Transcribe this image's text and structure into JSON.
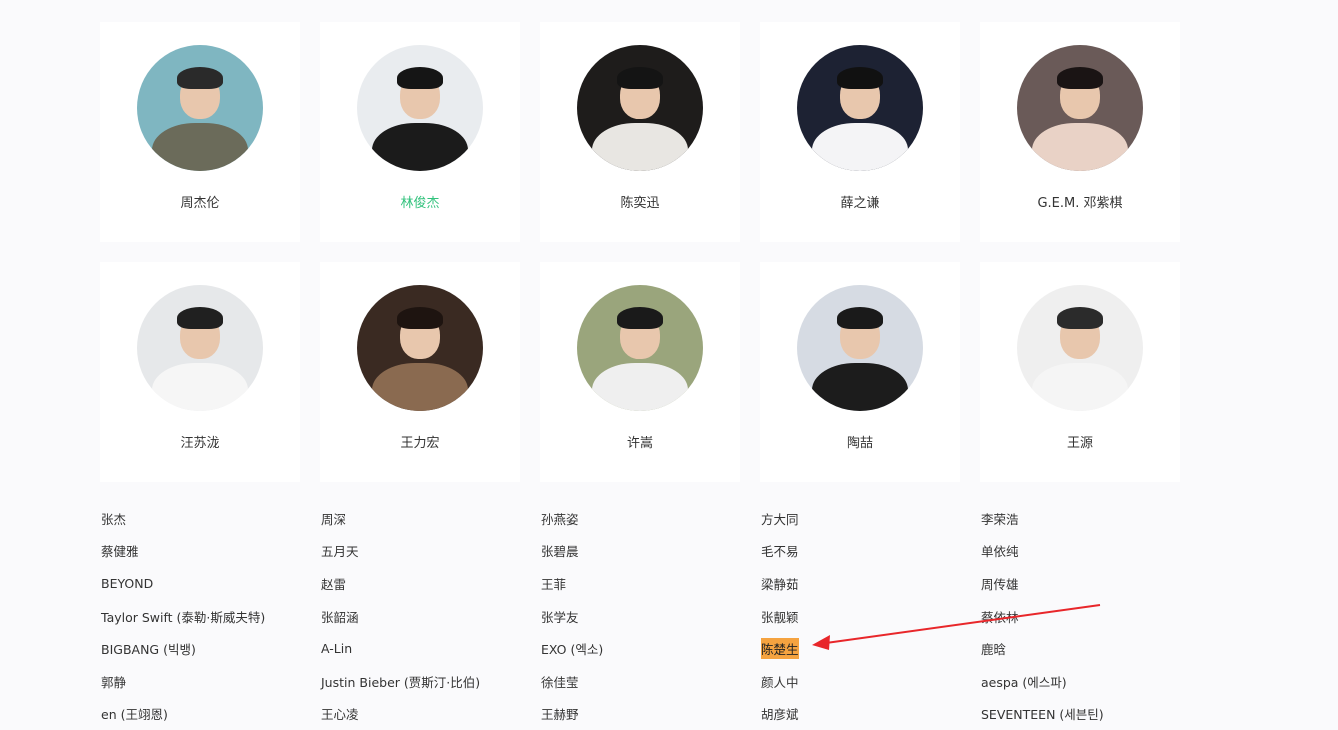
{
  "featured_singers": [
    {
      "name": "周杰伦",
      "active": false,
      "bg": "#7fb6c1",
      "body": "#6b6b5a",
      "hair": "#2a2a2a"
    },
    {
      "name": "林俊杰",
      "active": true,
      "bg": "#e9ecef",
      "body": "#1b1b1b",
      "hair": "#151515"
    },
    {
      "name": "陈奕迅",
      "active": false,
      "bg": "#1e1c1b",
      "body": "#e8e6e2",
      "hair": "#141414"
    },
    {
      "name": "薛之谦",
      "active": false,
      "bg": "#1d2233",
      "body": "#f4f4f6",
      "hair": "#111111"
    },
    {
      "name": "G.E.M. 邓紫棋",
      "active": false,
      "bg": "#6a5a58",
      "body": "#e9d2c6",
      "hair": "#1a1414"
    },
    {
      "name": "汪苏泷",
      "active": false,
      "bg": "#e6e8ea",
      "body": "#f6f6f6",
      "hair": "#202020"
    },
    {
      "name": "王力宏",
      "active": false,
      "bg": "#3a2a22",
      "body": "#8a6a50",
      "hair": "#1e1410"
    },
    {
      "name": "许嵩",
      "active": false,
      "bg": "#9aa57c",
      "body": "#efefef",
      "hair": "#1a1a1a"
    },
    {
      "name": "陶喆",
      "active": false,
      "bg": "#d6dbe3",
      "body": "#1c1c1c",
      "hair": "#1a1a1a"
    },
    {
      "name": "王源",
      "active": false,
      "bg": "#efefef",
      "body": "#f5f5f5",
      "hair": "#2b2b2b"
    }
  ],
  "singer_list": [
    [
      "张杰",
      "周深",
      "孙燕姿",
      "方大同",
      "李荣浩"
    ],
    [
      "蔡健雅",
      "五月天",
      "张碧晨",
      "毛不易",
      "单依纯"
    ],
    [
      "BEYOND",
      "赵雷",
      "王菲",
      "梁静茹",
      "周传雄"
    ],
    [
      "Taylor Swift (泰勒·斯威夫特)",
      "张韶涵",
      "张学友",
      "张靓颖",
      "蔡依林"
    ],
    [
      "BIGBANG (빅뱅)",
      "A-Lin",
      "EXO (엑소)",
      "陈楚生",
      "鹿晗"
    ],
    [
      "郭静",
      "Justin Bieber (贾斯汀·比伯)",
      "徐佳莹",
      "颜人中",
      "aespa (에스파)"
    ],
    [
      "en (王翊恩)",
      "王心凌",
      "王赫野",
      "胡彦斌",
      "SEVENTEEN (세븐틴)"
    ]
  ],
  "highlighted_singer": "陈楚生",
  "colors": {
    "active": "#31c27c",
    "highlight": "#f5a340",
    "annotation_arrow": "#e8262a"
  }
}
